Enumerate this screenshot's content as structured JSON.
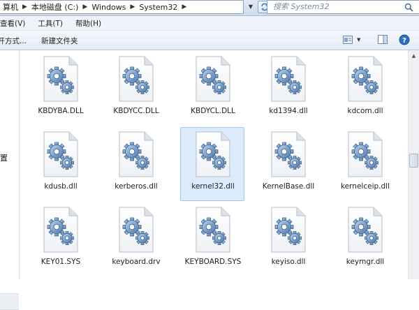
{
  "address": {
    "crumbs": [
      "算机",
      "本地磁盘 (C:)",
      "Windows",
      "System32"
    ],
    "search_placeholder": "搜索 System32"
  },
  "menu": {
    "items": [
      "查看(V)",
      "工具(T)",
      "帮助(H)"
    ]
  },
  "toolbar": {
    "open_with": "打开方式...",
    "new_folder": "新建文件夹"
  },
  "nav": {
    "partial_label": "置"
  },
  "files": [
    {
      "name": "KBDYBA.DLL"
    },
    {
      "name": "KBDYCC.DLL"
    },
    {
      "name": "KBDYCL.DLL"
    },
    {
      "name": "kd1394.dll"
    },
    {
      "name": "kdcom.dll"
    },
    {
      "name": "kdusb.dll"
    },
    {
      "name": "kerberos.dll"
    },
    {
      "name": "kernel32.dll",
      "selected": true
    },
    {
      "name": "KernelBase.dll"
    },
    {
      "name": "kernelceip.dll"
    },
    {
      "name": "KEY01.SYS"
    },
    {
      "name": "keyboard.drv"
    },
    {
      "name": "KEYBOARD.SYS"
    },
    {
      "name": "keyiso.dll"
    },
    {
      "name": "keymgr.dll"
    }
  ],
  "colors": {
    "selection_bg": "#dcebfc",
    "selection_border": "#a3c6ef",
    "gear_blue": "#5f87b4"
  },
  "icons": {
    "file_icon": "system-file-gear-icon",
    "refresh": "refresh-icon",
    "search": "search-icon",
    "help": "help-icon"
  }
}
